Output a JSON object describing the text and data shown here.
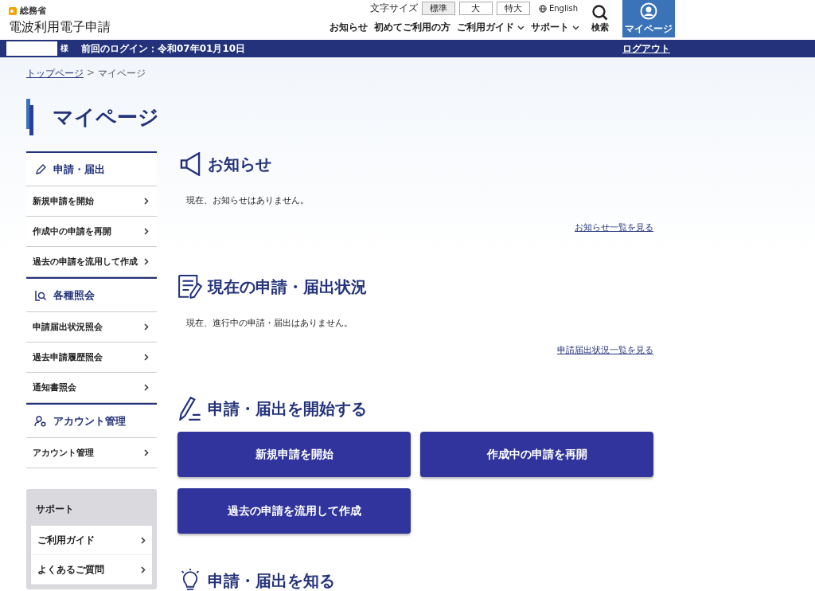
{
  "header": {
    "agency": "総務省",
    "title": "電波利用電子申請",
    "font_size": {
      "label": "文字サイズ",
      "options": [
        {
          "label": "標準",
          "selected": true
        },
        {
          "label": "大",
          "selected": false
        },
        {
          "label": "特大",
          "selected": false
        }
      ]
    },
    "language": "English",
    "nav": [
      {
        "label": "お知らせ",
        "dropdown": false
      },
      {
        "label": "初めてご利用の方",
        "dropdown": false
      },
      {
        "label": "ご利用ガイド",
        "dropdown": true
      },
      {
        "label": "サポート",
        "dropdown": true
      }
    ],
    "search_label": "検索",
    "mypage_label": "マイページ"
  },
  "user_bar": {
    "suffix": "様",
    "last_login": "前回のログイン：令和07年01月10日",
    "logout": "ログアウト"
  },
  "breadcrumb": [
    {
      "label": "トップページ",
      "kind": "link"
    },
    {
      "label": ">",
      "kind": "separator"
    },
    {
      "label": "マイページ",
      "kind": "current"
    }
  ],
  "page_title": "マイページ",
  "sidebar": {
    "sections": [
      {
        "title": "申請・届出",
        "items": [
          "新規申請を開始",
          "作成中の申請を再開",
          "過去の申請を流用して作成"
        ]
      },
      {
        "title": "各種照会",
        "items": [
          "申請届出状況照会",
          "過去申請履歴照会",
          "通知書照会"
        ]
      },
      {
        "title": "アカウント管理",
        "items": [
          "アカウント管理"
        ]
      }
    ],
    "support": {
      "title": "サポート",
      "items": [
        "ご利用ガイド",
        "よくあるご質問"
      ]
    }
  },
  "main": {
    "notices": {
      "title": "お知らせ",
      "message": "現在、お知らせはありません。",
      "link": "お知らせ一覧を見る"
    },
    "status": {
      "title": "現在の申請・届出状況",
      "message": "現在、進行中の申請・届出はありません。",
      "link": "申請届出状況一覧を見る"
    },
    "start": {
      "title": "申請・届出を開始する",
      "buttons": [
        "新規申請を開始",
        "作成中の申請を再開",
        "過去の申請を流用して作成"
      ]
    },
    "learn": {
      "title": "申請・届出を知る"
    }
  }
}
